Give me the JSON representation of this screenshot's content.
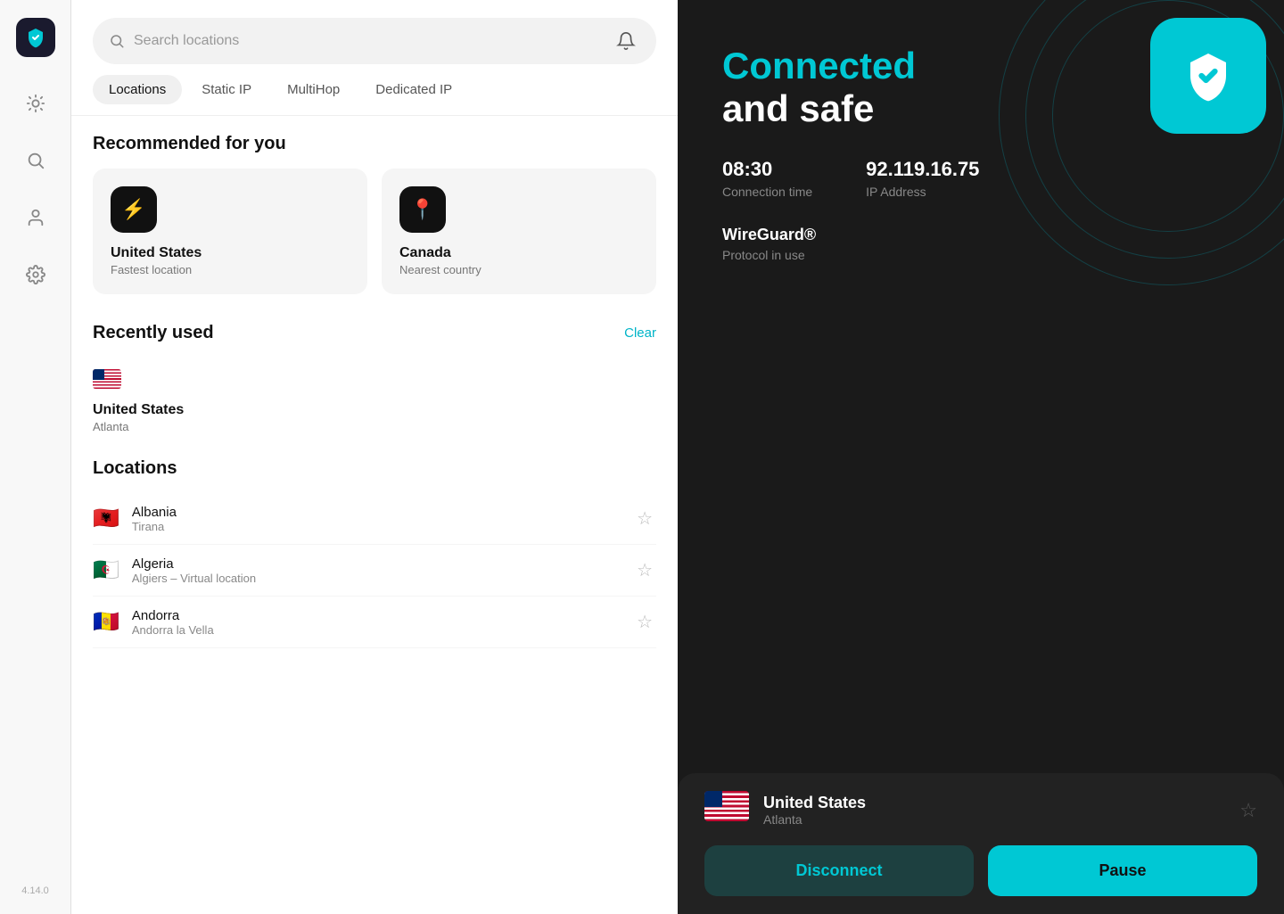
{
  "app": {
    "version": "4.14.0"
  },
  "sidebar": {
    "items": [
      {
        "name": "shield-logo",
        "icon": "🛡"
      },
      {
        "name": "brightness-icon",
        "icon": "☀"
      },
      {
        "name": "search-icon",
        "icon": "🔍"
      },
      {
        "name": "person-icon",
        "icon": "👤"
      },
      {
        "name": "settings-icon",
        "icon": "⚙"
      }
    ]
  },
  "search": {
    "placeholder": "Search locations"
  },
  "tabs": [
    {
      "id": "locations",
      "label": "Locations",
      "active": true
    },
    {
      "id": "static-ip",
      "label": "Static IP",
      "active": false
    },
    {
      "id": "multihop",
      "label": "MultiHop",
      "active": false
    },
    {
      "id": "dedicated-ip",
      "label": "Dedicated IP",
      "active": false
    }
  ],
  "sections": {
    "recommended": {
      "title": "Recommended for you",
      "cards": [
        {
          "icon": "⚡",
          "country": "United States",
          "subtitle": "Fastest location"
        },
        {
          "icon": "📍",
          "country": "Canada",
          "subtitle": "Nearest country"
        }
      ]
    },
    "recently_used": {
      "title": "Recently used",
      "clear_label": "Clear",
      "items": [
        {
          "flag": "🇺🇸",
          "country": "United States",
          "city": "Atlanta"
        }
      ]
    },
    "locations": {
      "title": "Locations",
      "items": [
        {
          "flag": "🇦🇱",
          "country": "Albania",
          "city": "Tirana",
          "virtual": false
        },
        {
          "flag": "🇩🇿",
          "country": "Algeria",
          "city": "Algiers – Virtual location",
          "virtual": true
        },
        {
          "flag": "🇦🇩",
          "country": "Andorra",
          "city": "Andorra la Vella",
          "virtual": false
        }
      ]
    }
  },
  "right_panel": {
    "status_line1": "Connected",
    "status_line2": "and safe",
    "connection_time_value": "08:30",
    "connection_time_label": "Connection time",
    "ip_address_value": "92.119.16.75",
    "ip_address_label": "IP Address",
    "protocol_value": "WireGuard®",
    "protocol_label": "Protocol in use",
    "connected_country": "United States",
    "connected_city": "Atlanta",
    "disconnect_label": "Disconnect",
    "pause_label": "Pause"
  }
}
